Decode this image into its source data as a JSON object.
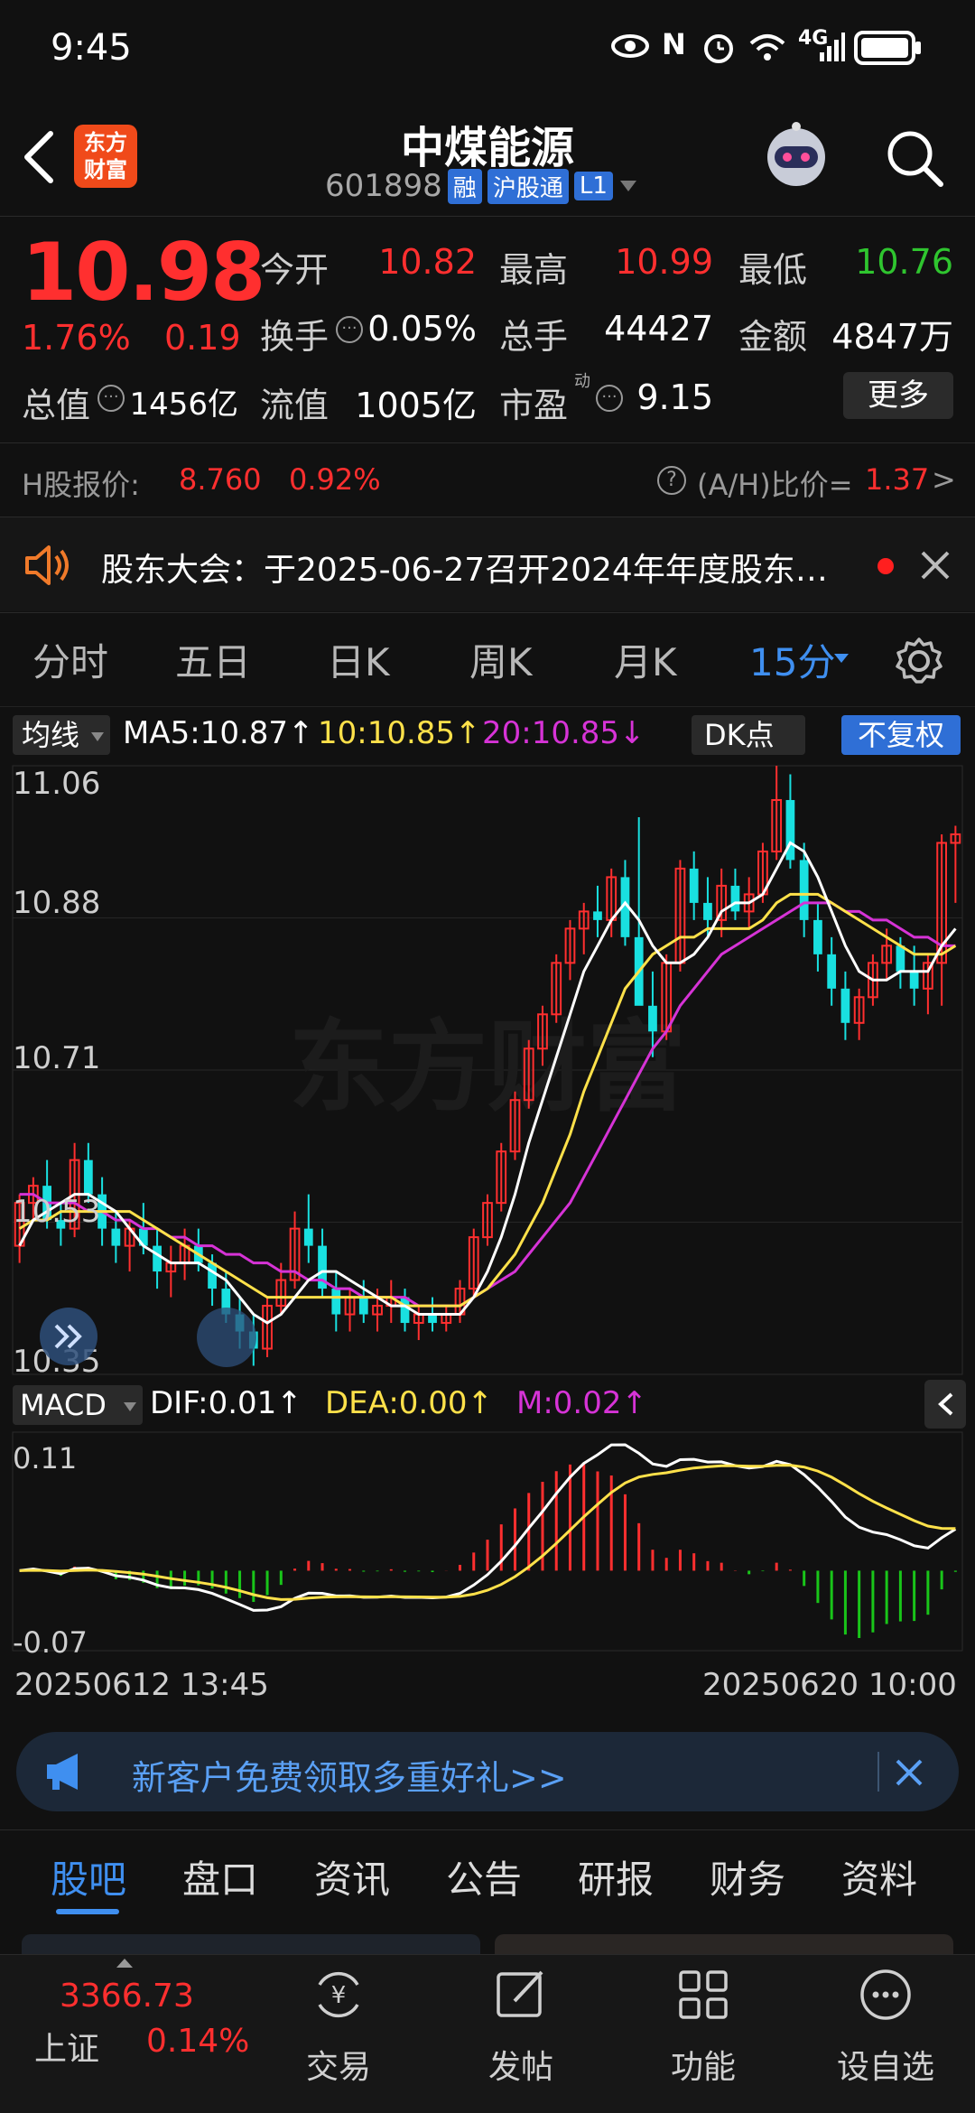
{
  "status": {
    "time": "9:45",
    "network": "4G"
  },
  "header": {
    "title": "中煤能源",
    "code": "601898",
    "tags": [
      "融",
      "沪股通",
      "L1"
    ],
    "logo_line1": "东方",
    "logo_line2": "财富"
  },
  "quote": {
    "price": "10.98",
    "change_pct": "1.76%",
    "change": "0.19",
    "open_label": "今开",
    "open": "10.82",
    "high_label": "最高",
    "high": "10.99",
    "low_label": "最低",
    "low": "10.76",
    "turnover_label": "换手",
    "turnover": "0.05%",
    "volume_label": "总手",
    "volume": "44427",
    "amount_label": "金额",
    "amount": "4847万",
    "mcap_label": "总值",
    "mcap": "1456亿",
    "float_label": "流值",
    "float": "1005亿",
    "pe_label": "市盈",
    "pe_sup": "动",
    "pe": "9.15",
    "more_label": "更多"
  },
  "hshare": {
    "label": "H股报价:",
    "price": "8.760",
    "pct": "0.92%",
    "ratio_label": "(A/H)比价=",
    "ratio": "1.37",
    "arrow": ">"
  },
  "notice": {
    "text": "股东大会：于2025-06-27召开2024年年度股东…"
  },
  "ktabs": [
    "分时",
    "五日",
    "日K",
    "周K",
    "月K",
    "15分"
  ],
  "ma": {
    "label": "均线",
    "ma5": "MA5:10.87↑",
    "ma10": "10:10.85↑",
    "ma20": "20:10.85↓",
    "dk": "DK点",
    "fq": "不复权",
    "colors": {
      "ma5": "#ffffff",
      "ma10": "#ffe14a",
      "ma20": "#d633d6"
    }
  },
  "chart_data": {
    "type": "candlestick",
    "y_ticks": [
      "11.06",
      "10.88",
      "10.71",
      "10.53",
      "10.35"
    ],
    "ylim": [
      10.35,
      11.06
    ],
    "candles": [
      [
        10.5,
        10.56,
        10.48,
        10.55
      ],
      [
        10.55,
        10.58,
        10.53,
        10.57
      ],
      [
        10.57,
        10.6,
        10.52,
        10.53
      ],
      [
        10.53,
        10.55,
        10.5,
        10.52
      ],
      [
        10.52,
        10.62,
        10.51,
        10.6
      ],
      [
        10.6,
        10.62,
        10.55,
        10.56
      ],
      [
        10.56,
        10.58,
        10.5,
        10.52
      ],
      [
        10.52,
        10.54,
        10.48,
        10.5
      ],
      [
        10.5,
        10.53,
        10.47,
        10.52
      ],
      [
        10.52,
        10.55,
        10.49,
        10.5
      ],
      [
        10.5,
        10.52,
        10.45,
        10.47
      ],
      [
        10.47,
        10.5,
        10.44,
        10.48
      ],
      [
        10.48,
        10.52,
        10.46,
        10.5
      ],
      [
        10.5,
        10.52,
        10.47,
        10.48
      ],
      [
        10.48,
        10.49,
        10.43,
        10.45
      ],
      [
        10.45,
        10.47,
        10.41,
        10.42
      ],
      [
        10.42,
        10.44,
        10.38,
        10.4
      ],
      [
        10.4,
        10.42,
        10.36,
        10.38
      ],
      [
        10.38,
        10.44,
        10.37,
        10.43
      ],
      [
        10.43,
        10.48,
        10.42,
        10.46
      ],
      [
        10.46,
        10.54,
        10.45,
        10.52
      ],
      [
        10.52,
        10.56,
        10.48,
        10.5
      ],
      [
        10.5,
        10.52,
        10.44,
        10.45
      ],
      [
        10.45,
        10.47,
        10.4,
        10.42
      ],
      [
        10.42,
        10.45,
        10.4,
        10.44
      ],
      [
        10.44,
        10.46,
        10.41,
        10.42
      ],
      [
        10.42,
        10.45,
        10.4,
        10.43
      ],
      [
        10.43,
        10.46,
        10.41,
        10.44
      ],
      [
        10.44,
        10.45,
        10.4,
        10.41
      ],
      [
        10.41,
        10.43,
        10.39,
        10.42
      ],
      [
        10.42,
        10.44,
        10.4,
        10.41
      ],
      [
        10.41,
        10.43,
        10.4,
        10.42
      ],
      [
        10.42,
        10.46,
        10.41,
        10.45
      ],
      [
        10.45,
        10.52,
        10.44,
        10.51
      ],
      [
        10.51,
        10.56,
        10.5,
        10.55
      ],
      [
        10.55,
        10.62,
        10.54,
        10.61
      ],
      [
        10.61,
        10.68,
        10.6,
        10.67
      ],
      [
        10.67,
        10.74,
        10.66,
        10.73
      ],
      [
        10.73,
        10.78,
        10.71,
        10.77
      ],
      [
        10.77,
        10.84,
        10.76,
        10.83
      ],
      [
        10.83,
        10.88,
        10.81,
        10.87
      ],
      [
        10.87,
        10.9,
        10.84,
        10.89
      ],
      [
        10.89,
        10.92,
        10.86,
        10.88
      ],
      [
        10.88,
        10.94,
        10.86,
        10.93
      ],
      [
        10.93,
        10.95,
        10.85,
        10.86
      ],
      [
        10.86,
        11.0,
        10.84,
        10.78
      ],
      [
        10.78,
        10.82,
        10.72,
        10.75
      ],
      [
        10.75,
        10.84,
        10.74,
        10.83
      ],
      [
        10.83,
        10.95,
        10.82,
        10.94
      ],
      [
        10.94,
        10.96,
        10.88,
        10.9
      ],
      [
        10.9,
        10.93,
        10.86,
        10.88
      ],
      [
        10.88,
        10.94,
        10.86,
        10.92
      ],
      [
        10.92,
        10.94,
        10.88,
        10.89
      ],
      [
        10.89,
        10.93,
        10.87,
        10.91
      ],
      [
        10.91,
        10.97,
        10.9,
        10.96
      ],
      [
        10.96,
        11.06,
        10.95,
        11.02
      ],
      [
        11.02,
        11.05,
        10.94,
        10.95
      ],
      [
        10.95,
        10.97,
        10.86,
        10.88
      ],
      [
        10.88,
        10.9,
        10.82,
        10.84
      ],
      [
        10.84,
        10.86,
        10.78,
        10.8
      ],
      [
        10.8,
        10.82,
        10.74,
        10.76
      ],
      [
        10.76,
        10.8,
        10.74,
        10.79
      ],
      [
        10.79,
        10.84,
        10.78,
        10.83
      ],
      [
        10.83,
        10.87,
        10.81,
        10.85
      ],
      [
        10.85,
        10.86,
        10.8,
        10.82
      ],
      [
        10.82,
        10.85,
        10.78,
        10.8
      ],
      [
        10.8,
        10.84,
        10.77,
        10.83
      ],
      [
        10.83,
        10.98,
        10.78,
        10.97
      ],
      [
        10.97,
        10.99,
        10.9,
        10.98
      ]
    ],
    "ma5": [
      10.5,
      10.53,
      10.54,
      10.55,
      10.56,
      10.56,
      10.55,
      10.54,
      10.52,
      10.5,
      10.49,
      10.48,
      10.48,
      10.48,
      10.47,
      10.46,
      10.44,
      10.42,
      10.41,
      10.42,
      10.44,
      10.46,
      10.47,
      10.47,
      10.46,
      10.45,
      10.44,
      10.43,
      10.43,
      10.42,
      10.42,
      10.42,
      10.42,
      10.44,
      10.47,
      10.51,
      10.56,
      10.62,
      10.67,
      10.72,
      10.77,
      10.82,
      10.85,
      10.88,
      10.9,
      10.88,
      10.85,
      10.83,
      10.83,
      10.84,
      10.86,
      10.89,
      10.9,
      10.9,
      10.91,
      10.94,
      10.97,
      10.96,
      10.93,
      10.89,
      10.85,
      10.82,
      10.81,
      10.81,
      10.82,
      10.82,
      10.82,
      10.85,
      10.87
    ],
    "ma10": [
      10.52,
      10.53,
      10.53,
      10.54,
      10.54,
      10.54,
      10.54,
      10.54,
      10.54,
      10.53,
      10.52,
      10.51,
      10.5,
      10.49,
      10.48,
      10.47,
      10.46,
      10.45,
      10.44,
      10.44,
      10.44,
      10.44,
      10.44,
      10.44,
      10.44,
      10.44,
      10.44,
      10.44,
      10.43,
      10.43,
      10.43,
      10.43,
      10.43,
      10.44,
      10.45,
      10.47,
      10.49,
      10.52,
      10.55,
      10.59,
      10.63,
      10.68,
      10.72,
      10.76,
      10.8,
      10.82,
      10.84,
      10.85,
      10.86,
      10.86,
      10.87,
      10.87,
      10.87,
      10.87,
      10.88,
      10.9,
      10.91,
      10.91,
      10.91,
      10.9,
      10.89,
      10.88,
      10.87,
      10.86,
      10.85,
      10.84,
      10.84,
      10.84,
      10.85
    ],
    "ma20": [
      10.56,
      10.56,
      10.55,
      10.55,
      10.55,
      10.54,
      10.54,
      10.53,
      10.53,
      10.52,
      10.52,
      10.51,
      10.51,
      10.5,
      10.5,
      10.49,
      10.49,
      10.48,
      10.48,
      10.47,
      10.47,
      10.46,
      10.46,
      10.45,
      10.45,
      10.44,
      10.44,
      10.44,
      10.44,
      10.43,
      10.43,
      10.43,
      10.43,
      10.44,
      10.45,
      10.46,
      10.47,
      10.49,
      10.51,
      10.53,
      10.55,
      10.58,
      10.61,
      10.64,
      10.67,
      10.7,
      10.73,
      10.75,
      10.78,
      10.8,
      10.82,
      10.84,
      10.85,
      10.86,
      10.87,
      10.88,
      10.89,
      10.9,
      10.9,
      10.9,
      10.89,
      10.89,
      10.88,
      10.88,
      10.87,
      10.86,
      10.86,
      10.85,
      10.85
    ]
  },
  "macd": {
    "label": "MACD",
    "dif": "DIF:0.01↑",
    "dea": "DEA:0.00↑",
    "m": "M:0.02↑",
    "y_top": "0.11",
    "y_bottom": "-0.07",
    "date_start": "20250612 13:45",
    "date_end": "20250620 10:00"
  },
  "promo": {
    "text": "新客户免费领取多重好礼>>"
  },
  "bottom_tabs": [
    "股吧",
    "盘口",
    "资讯",
    "公告",
    "研报",
    "财务",
    "资料"
  ],
  "bottom_nav": {
    "index_value": "3366.73",
    "index_name": "上证",
    "index_pct": "0.14%",
    "items": [
      "交易",
      "发帖",
      "功能",
      "设自选"
    ]
  }
}
